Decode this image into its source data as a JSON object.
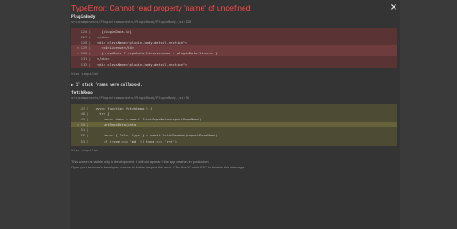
{
  "error": {
    "title": "TypeError: Cannot read property 'name' of undefined",
    "close_symbol": "×"
  },
  "frames": [
    {
      "name": "PluginBody",
      "path": "src/components/Plugin/components/PluginBody/PluginBody.jsx:128",
      "lines": [
        {
          "gutter": "  124 | ",
          "code": "    {pluginData.id}",
          "highlight": false
        },
        {
          "gutter": "  127 | ",
          "code": "  </div>",
          "highlight": false
        },
        {
          "gutter": "  128 | ",
          "code": "  <div className=\"plugin-body-detail-section\">",
          "highlight": false
        },
        {
          "gutter": "> 129 | ",
          "code": "    <h4>License</h4>",
          "highlight": true
        },
        {
          "gutter": "> 130 | ",
          "code": "    { repoData ? repoData.license.name : pluginData.license }",
          "highlight": true
        },
        {
          "gutter": "  131 | ",
          "code": "  </div>",
          "highlight": false
        },
        {
          "gutter": "  132 | ",
          "code": "  <div className=\"plugin-body-detail-section\">",
          "highlight": false
        }
      ],
      "view_compiled": "View compiled"
    },
    {
      "name": "fetchRepo",
      "path": "src/components/Plugin/components/PluginBody/PluginBody.jsx:50",
      "lines": [
        {
          "gutter": "  47 | ",
          "code": "  async function fetchRepo() {",
          "highlight": false
        },
        {
          "gutter": "  48 | ",
          "code": "    try {",
          "highlight": false
        },
        {
          "gutter": "  49 | ",
          "code": "      const data = await fetchRepoData(expectRepoName)",
          "highlight": false
        },
        {
          "gutter": "> 50 | ",
          "code": "      setRepoData(data)",
          "highlight": true
        },
        {
          "gutter": "  51 | ",
          "code": "",
          "highlight": false
        },
        {
          "gutter": "  52 | ",
          "code": "      const { file, type } = await fetchReadme(expectRepoName)",
          "highlight": false
        },
        {
          "gutter": "  53 | ",
          "code": "      if (type === 'md' || type === 'rst')",
          "highlight": false
        }
      ],
      "view_compiled": "View compiled"
    }
  ],
  "collapsed_label": "▶ 17 stack frames were collapsed.",
  "footer": {
    "line1": "This screen is visible only in development. It will not appear if the app crashes in production.",
    "line2": "Open your browser's developer console to further inspect this error.  Click the 'X' or hit ESC to dismiss this message."
  }
}
